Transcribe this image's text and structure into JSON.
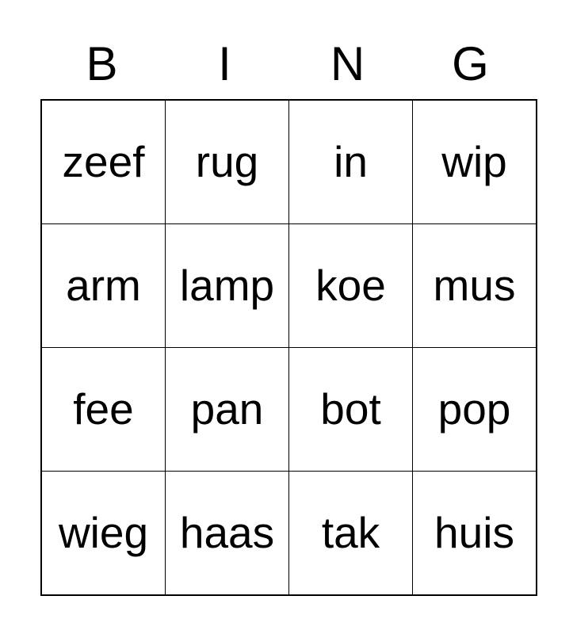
{
  "card": {
    "header_letters": [
      "B",
      "I",
      "N",
      "G"
    ],
    "rows": [
      [
        "zeef",
        "rug",
        "in",
        "wip"
      ],
      [
        "arm",
        "lamp",
        "koe",
        "mus"
      ],
      [
        "fee",
        "pan",
        "bot",
        "pop"
      ],
      [
        "wieg",
        "haas",
        "tak",
        "huis"
      ]
    ],
    "colors": {
      "background": "#ffffff",
      "text": "#000000",
      "grid_line": "#000000"
    }
  }
}
